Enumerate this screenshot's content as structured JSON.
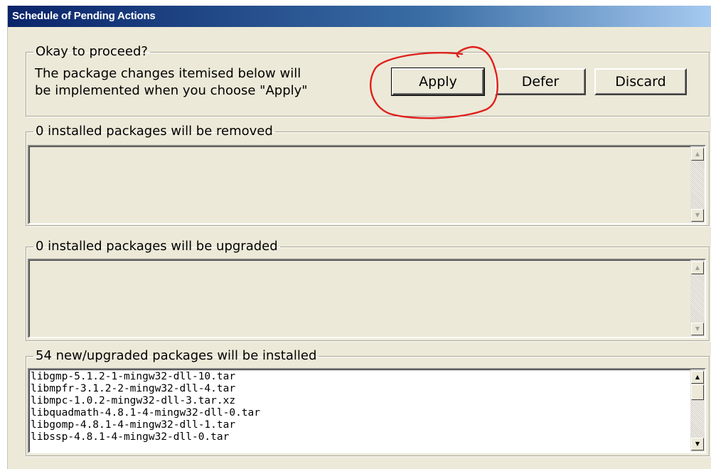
{
  "window": {
    "title": "Schedule of Pending Actions"
  },
  "proceed": {
    "legend": "Okay to proceed?",
    "description_line1": "The package changes itemised below will",
    "description_line2": "be implemented when you choose \"Apply\"",
    "apply_label": "Apply",
    "defer_label": "Defer",
    "discard_label": "Discard"
  },
  "removed": {
    "legend": "0 installed packages will be removed"
  },
  "upgraded": {
    "legend": "0 installed packages will be upgraded"
  },
  "installed": {
    "legend": "54 new/upgraded packages will be installed",
    "items": [
      "libgmp-5.1.2-1-mingw32-dll-10.tar",
      "libmpfr-3.1.2-2-mingw32-dll-4.tar",
      "libmpc-1.0.2-mingw32-dll-3.tar.xz",
      "libquadmath-4.8.1-4-mingw32-dll-0.tar",
      "libgomp-4.8.1-4-mingw32-dll-1.tar",
      "libssp-4.8.1-4-mingw32-dll-0.tar"
    ]
  },
  "icons": {
    "scroll_up": "scroll-up-arrow",
    "scroll_down": "scroll-down-arrow",
    "annotation": "red-hand-drawn-circle"
  },
  "colors": {
    "title_bar_start": "#0a246a",
    "title_bar_end": "#a6caf0",
    "window_background": "#ece9d8",
    "annotation": "#e0201c"
  }
}
